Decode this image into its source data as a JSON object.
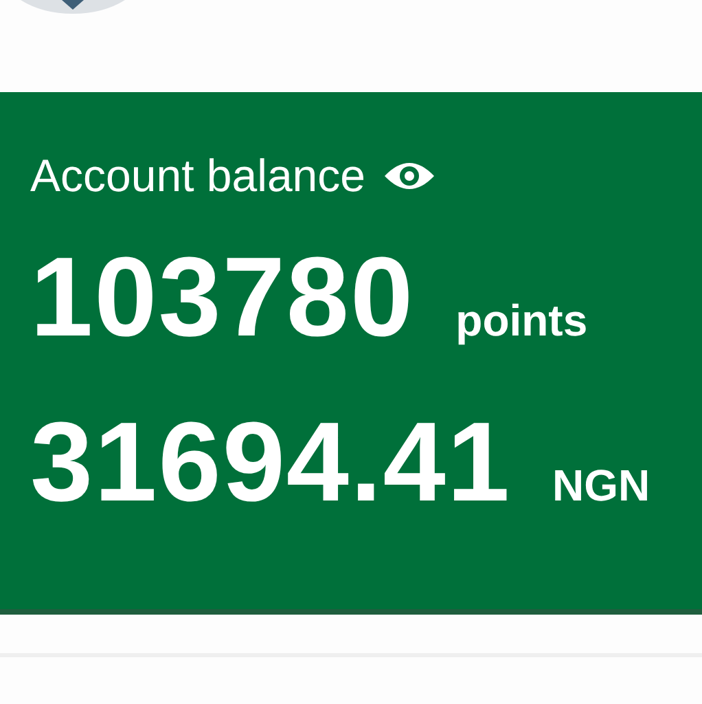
{
  "balance_card": {
    "title": "Account balance",
    "points": {
      "amount": "103780",
      "unit": "points"
    },
    "money": {
      "amount": "31694.41",
      "unit": "NGN"
    }
  }
}
